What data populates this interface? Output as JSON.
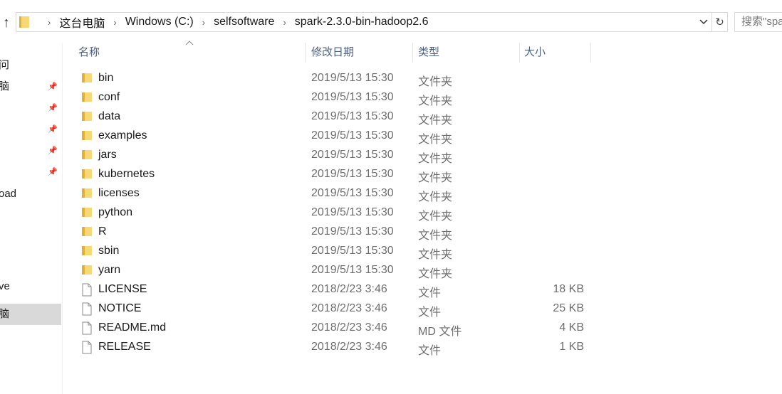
{
  "address_bar": {
    "crumbs": [
      "这台电脑",
      "Windows (C:)",
      "selfsoftware",
      "spark-2.3.0-bin-hadoop2.6"
    ]
  },
  "search": {
    "placeholder": "搜索\"spa"
  },
  "nav_pane": {
    "items": [
      {
        "label": "问"
      },
      {
        "label": "脑"
      },
      {
        "label": ""
      },
      {
        "label": ""
      },
      {
        "label": ""
      },
      {
        "label": ""
      },
      {
        "label": "oad"
      },
      {
        "label": "ve"
      },
      {
        "label": "脑"
      }
    ]
  },
  "columns": {
    "name": "名称",
    "date": "修改日期",
    "type": "类型",
    "size": "大小"
  },
  "files": [
    {
      "icon": "folder-icon",
      "name": "bin",
      "date": "2019/5/13 15:30",
      "type": "文件夹",
      "size": ""
    },
    {
      "icon": "folder-icon",
      "name": "conf",
      "date": "2019/5/13 15:30",
      "type": "文件夹",
      "size": ""
    },
    {
      "icon": "folder-icon",
      "name": "data",
      "date": "2019/5/13 15:30",
      "type": "文件夹",
      "size": ""
    },
    {
      "icon": "folder-icon",
      "name": "examples",
      "date": "2019/5/13 15:30",
      "type": "文件夹",
      "size": ""
    },
    {
      "icon": "folder-icon",
      "name": "jars",
      "date": "2019/5/13 15:30",
      "type": "文件夹",
      "size": ""
    },
    {
      "icon": "folder-icon",
      "name": "kubernetes",
      "date": "2019/5/13 15:30",
      "type": "文件夹",
      "size": ""
    },
    {
      "icon": "folder-icon",
      "name": "licenses",
      "date": "2019/5/13 15:30",
      "type": "文件夹",
      "size": ""
    },
    {
      "icon": "folder-icon",
      "name": "python",
      "date": "2019/5/13 15:30",
      "type": "文件夹",
      "size": ""
    },
    {
      "icon": "folder-icon",
      "name": "R",
      "date": "2019/5/13 15:30",
      "type": "文件夹",
      "size": ""
    },
    {
      "icon": "folder-icon",
      "name": "sbin",
      "date": "2019/5/13 15:30",
      "type": "文件夹",
      "size": ""
    },
    {
      "icon": "folder-icon",
      "name": "yarn",
      "date": "2019/5/13 15:30",
      "type": "文件夹",
      "size": ""
    },
    {
      "icon": "file-icon",
      "name": "LICENSE",
      "date": "2018/2/23 3:46",
      "type": "文件",
      "size": "18 KB"
    },
    {
      "icon": "file-icon",
      "name": "NOTICE",
      "date": "2018/2/23 3:46",
      "type": "文件",
      "size": "25 KB"
    },
    {
      "icon": "file-icon",
      "name": "README.md",
      "date": "2018/2/23 3:46",
      "type": "MD 文件",
      "size": "4 KB"
    },
    {
      "icon": "file-icon",
      "name": "RELEASE",
      "date": "2018/2/23 3:46",
      "type": "文件",
      "size": "1 KB"
    }
  ],
  "colors": {
    "folder": "#f8d775",
    "folder_dark": "#e0b03a",
    "header_text": "#4d6082",
    "secondary_text": "#6d6d6d",
    "selected_nav": "#d9d9d9"
  }
}
